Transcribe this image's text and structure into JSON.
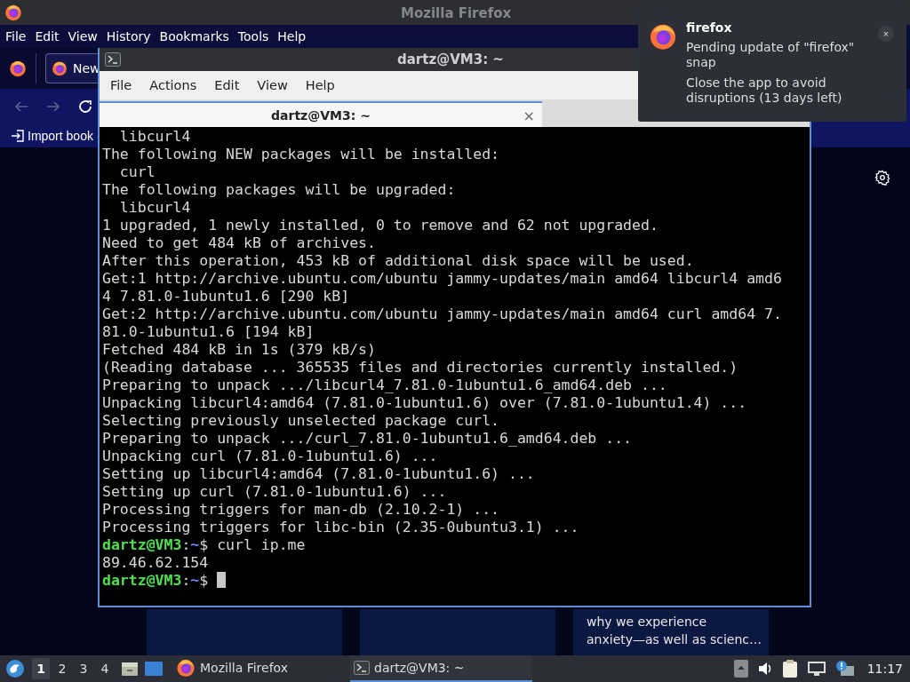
{
  "firefox_window": {
    "title": "Mozilla Firefox",
    "menu": [
      "File",
      "Edit",
      "View",
      "History",
      "Bookmarks",
      "Tools",
      "Help"
    ],
    "tab": {
      "label": "New"
    },
    "bookmarks": [
      {
        "label": "Import book"
      }
    ],
    "article_card": {
      "lines": [
        "why we experience",
        "anxiety—as well as scienc…"
      ]
    }
  },
  "terminal_window": {
    "title": "dartz@VM3: ~",
    "menu": [
      "File",
      "Actions",
      "Edit",
      "View",
      "Help"
    ],
    "tabs": [
      {
        "label": "dartz@VM3: ~",
        "selected": true,
        "close": "×"
      }
    ],
    "lines": [
      {
        "kind": "output",
        "text": "  libcurl4"
      },
      {
        "kind": "output",
        "text": "The following NEW packages will be installed:"
      },
      {
        "kind": "output",
        "text": "  curl"
      },
      {
        "kind": "output",
        "text": "The following packages will be upgraded:"
      },
      {
        "kind": "output",
        "text": "  libcurl4"
      },
      {
        "kind": "output",
        "text": "1 upgraded, 1 newly installed, 0 to remove and 62 not upgraded."
      },
      {
        "kind": "output",
        "text": "Need to get 484 kB of archives."
      },
      {
        "kind": "output",
        "text": "After this operation, 453 kB of additional disk space will be used."
      },
      {
        "kind": "output",
        "text": "Get:1 http://archive.ubuntu.com/ubuntu jammy-updates/main amd64 libcurl4 amd6"
      },
      {
        "kind": "output",
        "text": "4 7.81.0-1ubuntu1.6 [290 kB]"
      },
      {
        "kind": "output",
        "text": "Get:2 http://archive.ubuntu.com/ubuntu jammy-updates/main amd64 curl amd64 7."
      },
      {
        "kind": "output",
        "text": "81.0-1ubuntu1.6 [194 kB]"
      },
      {
        "kind": "output",
        "text": "Fetched 484 kB in 1s (379 kB/s)"
      },
      {
        "kind": "output",
        "text": "(Reading database ... 365535 files and directories currently installed.)"
      },
      {
        "kind": "output",
        "text": "Preparing to unpack .../libcurl4_7.81.0-1ubuntu1.6_amd64.deb ..."
      },
      {
        "kind": "output",
        "text": "Unpacking libcurl4:amd64 (7.81.0-1ubuntu1.6) over (7.81.0-1ubuntu1.4) ..."
      },
      {
        "kind": "output",
        "text": "Selecting previously unselected package curl."
      },
      {
        "kind": "output",
        "text": "Preparing to unpack .../curl_7.81.0-1ubuntu1.6_amd64.deb ..."
      },
      {
        "kind": "output",
        "text": "Unpacking curl (7.81.0-1ubuntu1.6) ..."
      },
      {
        "kind": "output",
        "text": "Setting up libcurl4:amd64 (7.81.0-1ubuntu1.6) ..."
      },
      {
        "kind": "output",
        "text": "Setting up curl (7.81.0-1ubuntu1.6) ..."
      },
      {
        "kind": "output",
        "text": "Processing triggers for man-db (2.10.2-1) ..."
      },
      {
        "kind": "output",
        "text": "Processing triggers for libc-bin (2.35-0ubuntu3.1) ..."
      },
      {
        "kind": "prompt",
        "user": "dartz@VM3",
        "sep": ":",
        "path": "~",
        "symbol": "$",
        "command": "curl ip.me",
        "cursor": false
      },
      {
        "kind": "output",
        "text": "89.46.62.154"
      },
      {
        "kind": "prompt",
        "user": "dartz@VM3",
        "sep": ":",
        "path": "~",
        "symbol": "$",
        "cursor": true
      }
    ]
  },
  "notification": {
    "app": "firefox",
    "title": "Pending update of \"firefox\" snap",
    "body": "Close the app to avoid disruptions (13 days left)",
    "close": "×"
  },
  "taskbar": {
    "workspaces": [
      {
        "label": "1",
        "selected": true
      },
      {
        "label": "2",
        "selected": false
      },
      {
        "label": "3",
        "selected": false
      },
      {
        "label": "4",
        "selected": false
      }
    ],
    "tasks": [
      {
        "kind": "browser",
        "label": "Mozilla Firefox",
        "selected": false
      },
      {
        "kind": "terminal",
        "label": "dartz@VM3: ~",
        "selected": true
      }
    ],
    "clock": "11:17"
  }
}
